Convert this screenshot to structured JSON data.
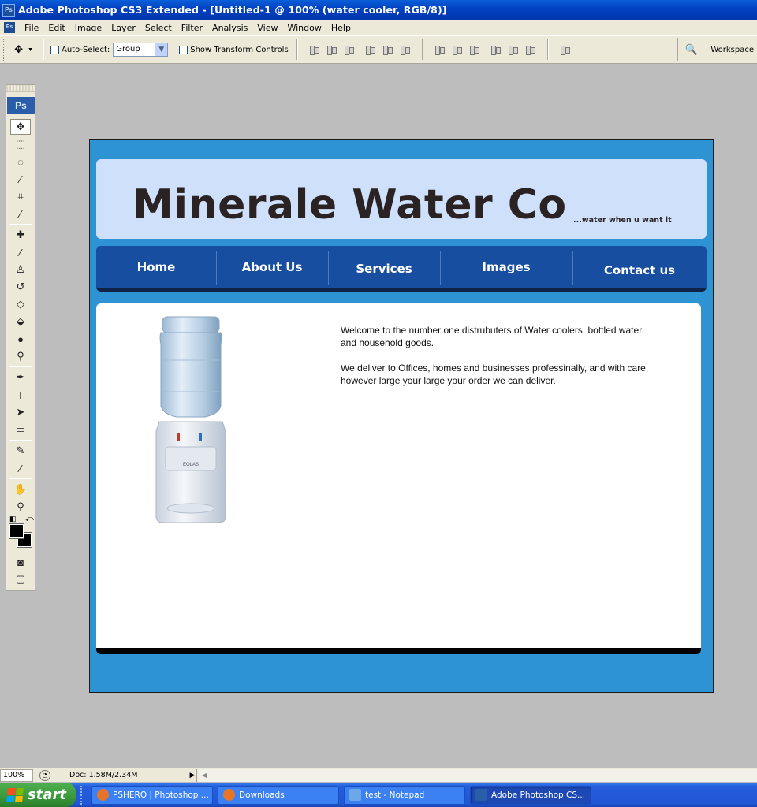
{
  "window": {
    "title": "Adobe Photoshop CS3 Extended - [Untitled-1 @ 100% (water cooler, RGB/8)]",
    "app_icon_label": "Ps"
  },
  "menubar": {
    "items": [
      "File",
      "Edit",
      "Image",
      "Layer",
      "Select",
      "Filter",
      "Analysis",
      "View",
      "Window",
      "Help"
    ]
  },
  "options_bar": {
    "auto_select_label": "Auto-Select:",
    "auto_select_value": "Group",
    "show_transform_label": "Show Transform Controls",
    "workspace_label": "Workspace"
  },
  "toolbox": {
    "logo": "Ps",
    "tools": [
      {
        "name": "move-tool",
        "glyph": "✥"
      },
      {
        "name": "marquee-tool",
        "glyph": "⬚"
      },
      {
        "name": "lasso-tool",
        "glyph": "◌"
      },
      {
        "name": "magic-wand-tool",
        "glyph": "⁄"
      },
      {
        "name": "crop-tool",
        "glyph": "⌗"
      },
      {
        "name": "eyedropper-slice-tool",
        "glyph": "⁄"
      },
      {
        "name": "healing-brush-tool",
        "glyph": "✚"
      },
      {
        "name": "brush-tool",
        "glyph": "∕"
      },
      {
        "name": "clone-stamp-tool",
        "glyph": "♙"
      },
      {
        "name": "history-brush-tool",
        "glyph": "↺"
      },
      {
        "name": "eraser-tool",
        "glyph": "◇"
      },
      {
        "name": "paint-bucket-tool",
        "glyph": "⬙"
      },
      {
        "name": "blur-tool",
        "glyph": "●"
      },
      {
        "name": "dodge-tool",
        "glyph": "⚲"
      },
      {
        "name": "pen-tool",
        "glyph": "✒"
      },
      {
        "name": "type-tool",
        "glyph": "T"
      },
      {
        "name": "path-selection-tool",
        "glyph": "➤"
      },
      {
        "name": "rectangle-tool",
        "glyph": "▭"
      },
      {
        "name": "notes-tool",
        "glyph": "✎"
      },
      {
        "name": "eyedropper-tool",
        "glyph": "⁄"
      },
      {
        "name": "hand-tool",
        "glyph": "✋"
      },
      {
        "name": "zoom-tool",
        "glyph": "⚲"
      }
    ],
    "foreground_color": "#000000",
    "background_color": "#000000"
  },
  "canvas": {
    "colors": {
      "background": "#2e93d2",
      "header_panel": "#cfe0fb",
      "nav": "#174ea0",
      "content": "#ffffff",
      "logo_text": "#2b2323"
    },
    "logo_text": "Minerale Water Co",
    "tagline": "...water when u want it",
    "nav_items": [
      "Home",
      "About Us",
      "Services",
      "Images",
      "Contact us"
    ],
    "paragraph1": "Welcome to the number one distrubuters of Water coolers, bottled water and household goods.",
    "paragraph2": "We deliver to Offices, homes and businesses professinally, and with care, however large your large your order we can deliver."
  },
  "statusbar": {
    "zoom": "100%",
    "doc": "Doc: 1.58M/2.34M"
  },
  "taskbar": {
    "start_label": "start",
    "tasks": [
      {
        "label": "PSHERO | Photoshop ...",
        "icon_color": "#e8742a"
      },
      {
        "label": "Downloads",
        "icon_color": "#e8742a"
      },
      {
        "label": "test - Notepad",
        "icon_color": "#6aa8e8"
      },
      {
        "label": "Adobe Photoshop CS...",
        "icon_color": "#2a5ea8"
      }
    ]
  }
}
